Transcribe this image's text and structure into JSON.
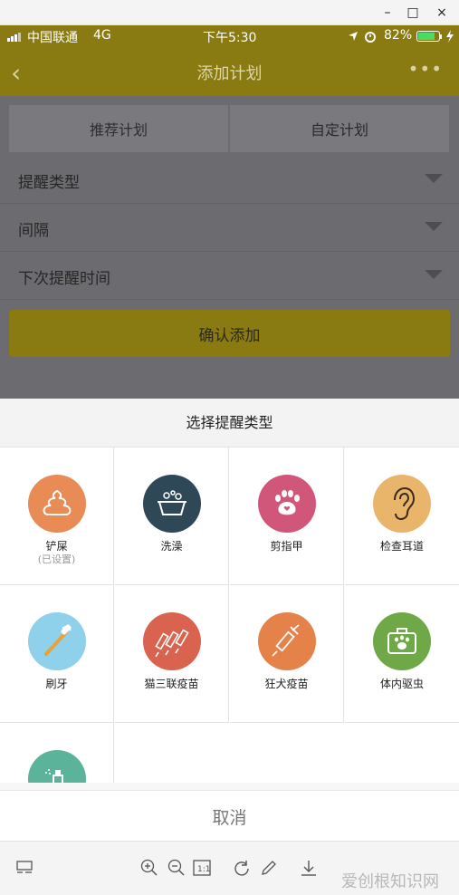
{
  "window": {
    "minimize": "–",
    "maximize": "□",
    "close": "×"
  },
  "status": {
    "carrier": "中国联通",
    "network": "4G",
    "time": "下午5:30",
    "battery": "82%",
    "battery_level": 0.82
  },
  "nav": {
    "title": "添加计划",
    "back": "‹",
    "more": "•••"
  },
  "tabs": {
    "recommended": "推荐计划",
    "custom": "自定计划"
  },
  "fields": {
    "reminder_type": "提醒类型",
    "interval": "间隔",
    "next_time": "下次提醒时间"
  },
  "confirm_label": "确认添加",
  "sheet": {
    "title": "选择提醒类型",
    "cancel": "取消"
  },
  "types": [
    {
      "label": "铲屎",
      "sub": "(已设置)",
      "icon": "poop-icon",
      "color": "#e88b54"
    },
    {
      "label": "洗澡",
      "sub": "",
      "icon": "bath-tub-icon",
      "color": "#2f4858"
    },
    {
      "label": "剪指甲",
      "sub": "",
      "icon": "paw-icon",
      "color": "#d1577a"
    },
    {
      "label": "检查耳道",
      "sub": "",
      "icon": "ear-icon",
      "color": "#e9b56a"
    },
    {
      "label": "刷牙",
      "sub": "",
      "icon": "toothbrush-icon",
      "color": "#8fd0ea"
    },
    {
      "label": "猫三联疫苗",
      "sub": "",
      "icon": "syringes-icon",
      "color": "#d9634f"
    },
    {
      "label": "狂犬疫苗",
      "sub": "",
      "icon": "syringe-icon",
      "color": "#e5824a"
    },
    {
      "label": "体内驱虫",
      "sub": "",
      "icon": "medical-kit-icon",
      "color": "#6fa846"
    },
    {
      "label": "",
      "sub": "",
      "icon": "spray-icon",
      "color": "#5bb39a"
    }
  ],
  "watermark": "爱创根知识网"
}
